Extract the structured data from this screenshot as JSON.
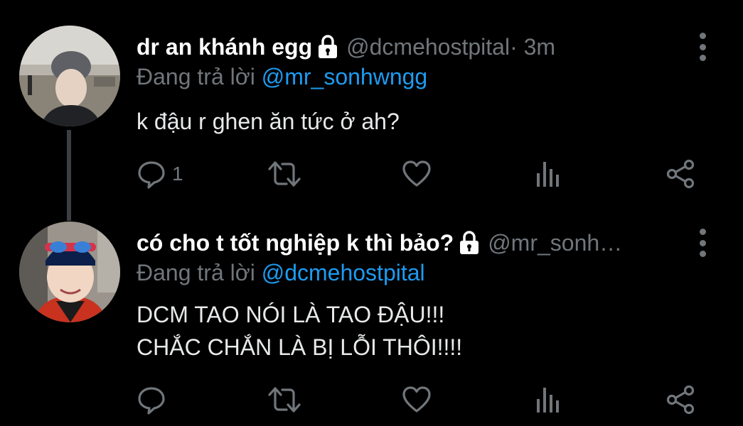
{
  "colors": {
    "background": "#000000",
    "text": "#e7e9ea",
    "muted": "#71767b",
    "link": "#1d9bf0",
    "thread_line": "#3a3f44"
  },
  "tweets": [
    {
      "display_name": "dr an khánh egg",
      "protected_icon": "lock-icon",
      "handle": "@dcmehostpital",
      "time": " · 3m",
      "reply_prefix": "Đang trả lời ",
      "reply_to": "@mr_sonhwngg",
      "text": "k đậu r ghen ăn tức ở ah?",
      "reply_count": "1"
    },
    {
      "display_name": "có cho t tốt nghiệp k thì bảo?",
      "protected_icon": "lock-icon",
      "handle": "@mr_sonh…",
      "reply_prefix": "Đang trả lời ",
      "reply_to": "@dcmehostpital",
      "text_line1": "DCM TAO NÓI LÀ TAO ĐẬU!!!",
      "text_line2": "CHẮC CHẮN LÀ BỊ LỖI THÔI!!!!"
    }
  ]
}
